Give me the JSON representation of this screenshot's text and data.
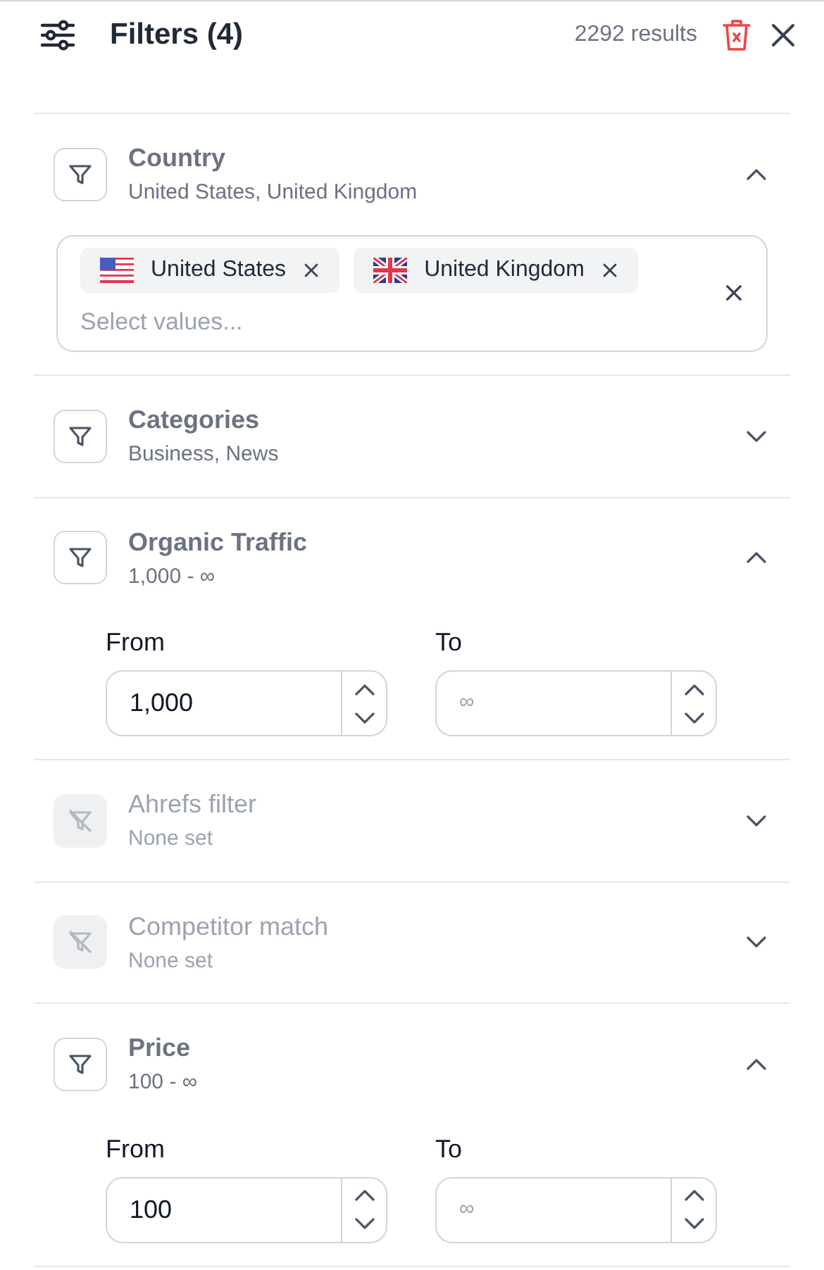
{
  "header": {
    "title": "Filters (4)",
    "results": "2292 results"
  },
  "sections": [
    {
      "kind": "multiselect",
      "title": "Country",
      "summary": "United States, United Kingdom",
      "expanded": true,
      "disabled": false,
      "tags": [
        {
          "label": "United States",
          "kind": "us_flag"
        },
        {
          "label": "United Kingdom",
          "kind": "uk_flag"
        }
      ],
      "placeholder": "Select values..."
    },
    {
      "title": "Categories",
      "summary": "Business, News",
      "expanded": false,
      "disabled": false
    },
    {
      "kind": "range",
      "title": "Organic Traffic",
      "summary": "1,000 - ∞",
      "expanded": true,
      "disabled": false,
      "from_label": "From",
      "from_value": "1,000",
      "to_label": "To",
      "to_placeholder": "∞"
    },
    {
      "title": "Ahrefs filter",
      "summary": "None set",
      "expanded": false,
      "disabled": true
    },
    {
      "title": "Competitor match",
      "summary": "None set",
      "expanded": false,
      "disabled": true
    },
    {
      "kind": "range",
      "title": "Price",
      "summary": "100 - ∞",
      "expanded": true,
      "disabled": false,
      "from_label": "From",
      "from_value": "100",
      "to_label": "To",
      "to_placeholder": "∞"
    }
  ]
}
